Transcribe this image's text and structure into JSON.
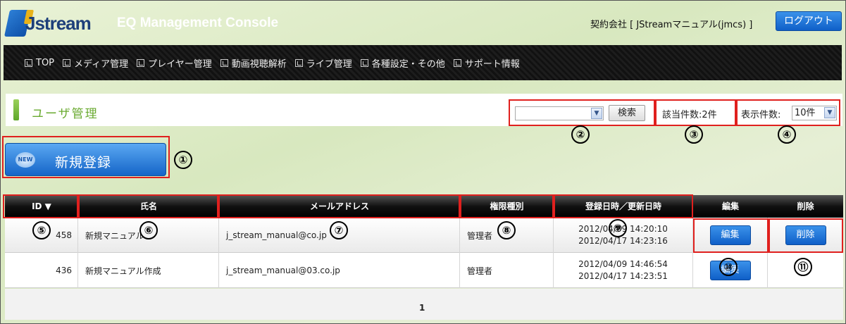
{
  "header": {
    "logo_text": "Jstream",
    "console_title": "EQ Management Console",
    "contract_label": "契約会社 [ JStreamマニュアル(jmcs) ]",
    "logout_label": "ログアウト"
  },
  "nav": {
    "items": [
      "TOP",
      "メディア管理",
      "プレイヤー管理",
      "動画視聴解析",
      "ライブ管理",
      "各種設定・その他",
      "サポート情報"
    ]
  },
  "page": {
    "title": "ユーザ管理",
    "search_value": "",
    "search_button": "検索",
    "count_label": "該当件数:2件",
    "display_label": "表示件数:",
    "display_value": "10件",
    "new_badge": "NEW",
    "new_button": "新規登録"
  },
  "table": {
    "columns": [
      "ID ▼",
      "氏名",
      "メールアドレス",
      "権限種別",
      "登録日時／更新日時",
      "編集",
      "削除"
    ],
    "rows": [
      {
        "id": "458",
        "name": "新規マニュアル",
        "email": "j_stream_manual@co.jp",
        "role": "管理者",
        "registered": "2012/04/09 14:20:10",
        "updated": "2012/04/17 14:23:16",
        "edit": "編集",
        "delete": "削除"
      },
      {
        "id": "436",
        "name": "新規マニュアル作成",
        "email": "j_stream_manual@03.co.jp",
        "role": "管理者",
        "registered": "2012/04/09 14:46:54",
        "updated": "2012/04/17 14:23:51",
        "edit": "編集",
        "delete": ""
      }
    ]
  },
  "pagination": {
    "current": "1"
  },
  "annotations": [
    "①",
    "②",
    "③",
    "④",
    "⑤",
    "⑥",
    "⑦",
    "⑧",
    "⑨",
    "⑩",
    "⑪"
  ],
  "colors": {
    "accent_blue": "#1565c8",
    "highlight_red": "#e0201e",
    "title_green": "#6aaa30",
    "nav_bg": "#111111"
  }
}
